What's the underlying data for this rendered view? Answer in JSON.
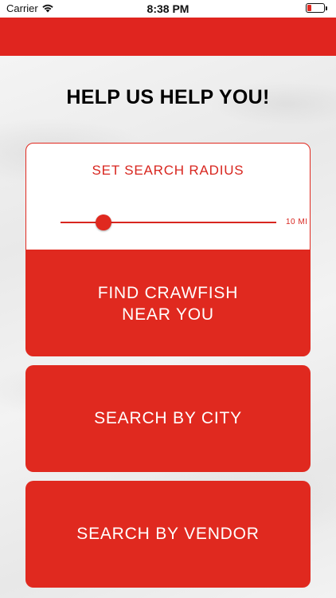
{
  "status_bar": {
    "carrier": "Carrier",
    "time": "8:38 PM",
    "wifi_icon": "wifi-icon",
    "battery_icon": "battery-icon",
    "charging_icon": "charging-bolt-icon",
    "battery_level": 0.2,
    "battery_color": "#e22a22"
  },
  "theme": {
    "brand_red": "#e0251f",
    "background": "#f1f1f1"
  },
  "page": {
    "title": "HELP US HELP YOU!"
  },
  "radius": {
    "label": "SET SEARCH RADIUS",
    "value_label": "10 MI",
    "slider_fraction": 0.2
  },
  "actions": {
    "find_line1": "FIND CRAWFISH",
    "find_line2": "NEAR YOU",
    "search_city": "SEARCH BY CITY",
    "search_vendor": "SEARCH BY VENDOR"
  }
}
